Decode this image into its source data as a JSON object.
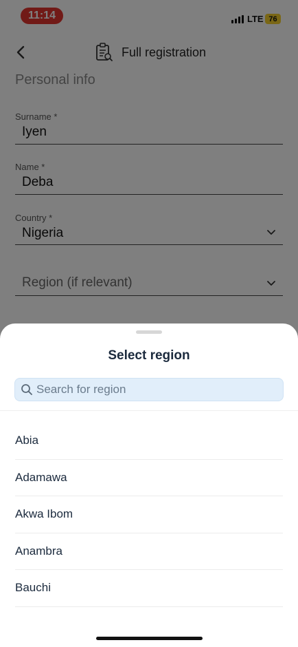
{
  "status_bar": {
    "time": "11:14",
    "network": "LTE",
    "battery": "76"
  },
  "nav": {
    "title": "Full registration"
  },
  "form": {
    "section_title": "Personal info",
    "surname": {
      "label": "Surname *",
      "value": "Iyen"
    },
    "name": {
      "label": "Name *",
      "value": "Deba"
    },
    "country": {
      "label": "Country *",
      "value": "Nigeria"
    },
    "region": {
      "placeholder": "Region (if relevant)"
    }
  },
  "sheet": {
    "title": "Select region",
    "search_placeholder": "Search for region",
    "regions": [
      "Abia",
      "Adamawa",
      "Akwa Ibom",
      "Anambra",
      "Bauchi"
    ]
  },
  "colors": {
    "accent_red": "#e3342f",
    "battery_yellow": "#f4cf2c",
    "search_bg": "#e1eefa",
    "title_navy": "#1b2a3d"
  }
}
